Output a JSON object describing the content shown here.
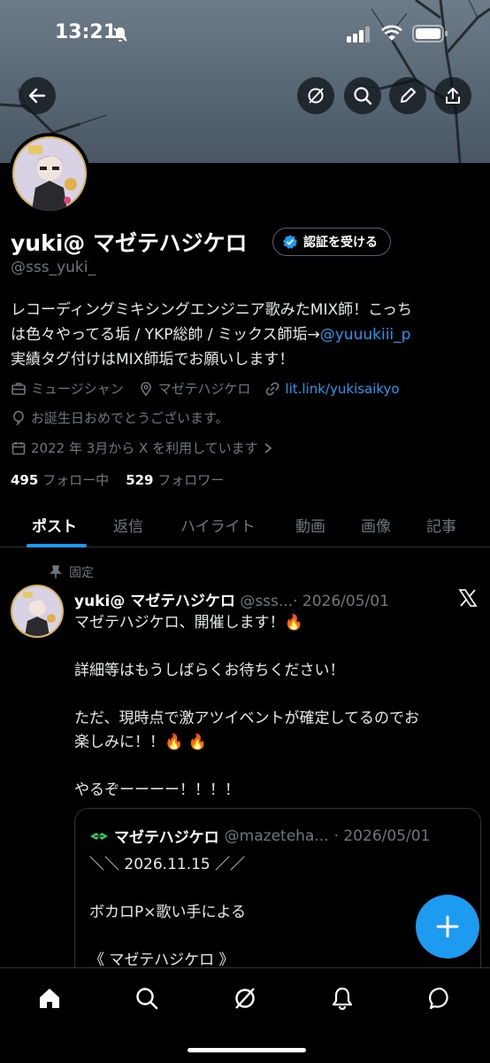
{
  "status_bar": {
    "time": "13:21"
  },
  "header": {
    "back_icon": "arrow-left-icon",
    "actions": [
      "grok-icon",
      "search-icon",
      "pencil-icon",
      "share-icon"
    ]
  },
  "profile": {
    "display_name": "yuki@ マゼテハジケロ",
    "verify_label": "認証を受ける",
    "handle": "@sss_yuki_",
    "bio_line1": "レコーディングミキシングエンジニア歌みたMIX師！こっち",
    "bio_line2_text": "は色々やってる垢 / YKP総帥 / ミックス師垢→",
    "bio_line2_link": "@yuuukiii_p",
    "bio_line3": "実績タグ付けはMIX師垢でお願いします！",
    "category": "ミュージシャン",
    "location": "マゼテハジケロ",
    "website": "lit.link/yukisaikyo",
    "birthday": "お誕生日おめでとうございます。",
    "joined": "2022 年 3月から X を利用しています",
    "following_count": "495",
    "following_label": "フォロー中",
    "followers_count": "529",
    "followers_label": "フォロワー"
  },
  "tabs": [
    "ポスト",
    "返信",
    "ハイライト",
    "動画",
    "画像",
    "記事"
  ],
  "post": {
    "pinned_label": "固定",
    "author": "yuki@ マゼテハジケロ",
    "handle": "@sss...",
    "date": "· 2026/05/01",
    "lines": [
      "マゼテハジケロ、開催します！🔥",
      "",
      "詳細等はもうしばらくお待ちください！",
      "",
      "ただ、現時点で激アツイベントが確定してるのでお",
      "楽しみに！！🔥 🔥",
      "",
      "やるぞーーーー！！！！"
    ],
    "quote": {
      "author": "マゼテハジケロ",
      "handle": "@mazeteha...",
      "date": "· 2026/05/01",
      "lines": [
        "＼＼ 2026.11.15 ／／",
        "",
        "ボカロP×歌い手による",
        "",
        "《 マゼテハジケロ 》"
      ]
    }
  },
  "colors": {
    "accent": "#1d9bf0",
    "muted": "#71767b",
    "background": "#000000"
  },
  "bottom_nav": [
    "home-icon",
    "search-icon",
    "grok-icon",
    "bell-icon",
    "messages-icon"
  ]
}
